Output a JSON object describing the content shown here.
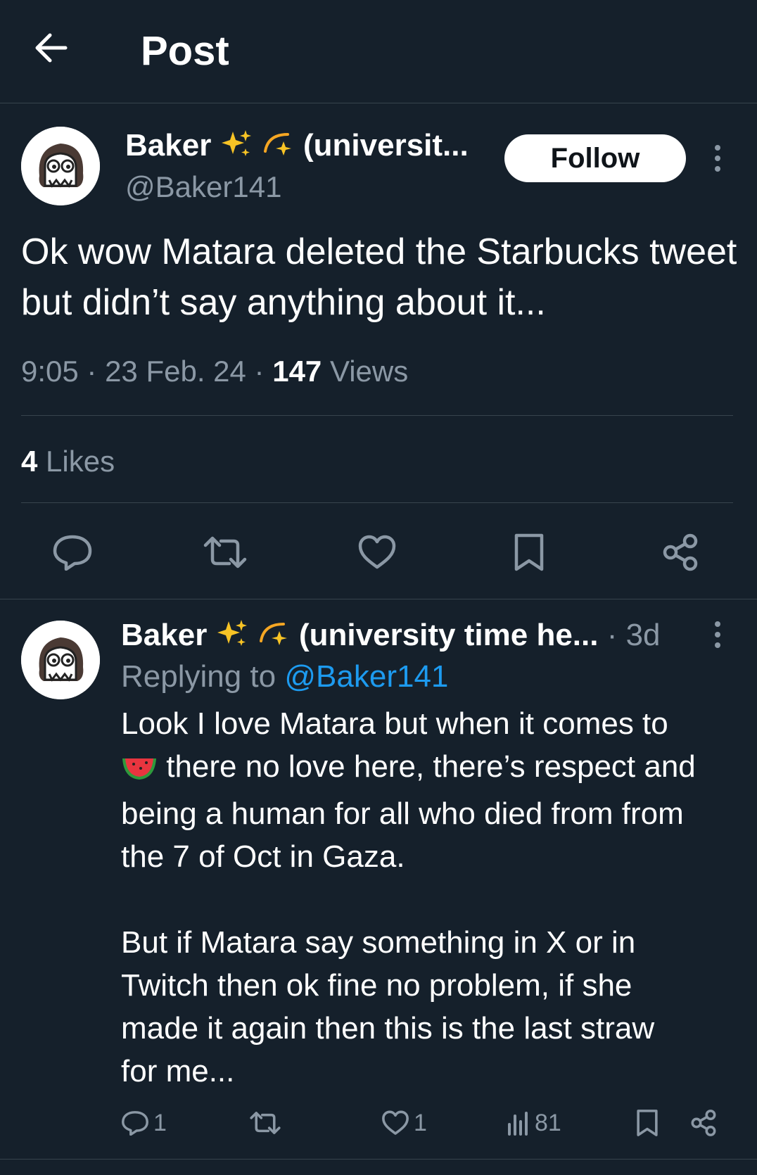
{
  "header": {
    "title": "Post"
  },
  "post": {
    "author": {
      "name": "Baker",
      "name_suffix": "(universit...",
      "handle": "@Baker141"
    },
    "follow_label": "Follow",
    "text": "Ok wow Matara deleted the Starbucks tweet but didn’t say anything about it...",
    "time": "9:05 · 23 Feb. 24 · ",
    "views_count": "147",
    "views_label": " Views",
    "likes_count": "4",
    "likes_label": " Likes"
  },
  "reply": {
    "author": {
      "name": "Baker",
      "name_suffix": "(university time he...",
      "time": " · 3d"
    },
    "replying_to_label": "Replying to ",
    "replying_to_handle": "@Baker141",
    "text_line1": "Look I love Matara but when it comes to",
    "text_rest": " there no love here, there’s respect and\nbeing a human for all who died from from\nthe 7 of Oct in Gaza.\n\nBut if Matara say something in X or in\nTwitch then ok fine no problem, if she\nmade it again then this is the last straw\nfor me...",
    "reply_count": "1",
    "like_count": "1",
    "view_count": "81"
  },
  "icons": {
    "back": "arrow-left-icon",
    "more": "more-vertical-icon",
    "reply": "reply-icon",
    "repost": "repost-icon",
    "like": "heart-icon",
    "bookmark": "bookmark-icon",
    "share": "share-icon",
    "views": "analytics-icon",
    "sparkles": "sparkles-emoji",
    "dizzy": "dizzy-emoji",
    "watermelon": "watermelon-emoji"
  },
  "colors": {
    "background": "#15202b",
    "divider": "#38444d",
    "muted": "#8b98a5",
    "accent": "#1d9bf0"
  }
}
